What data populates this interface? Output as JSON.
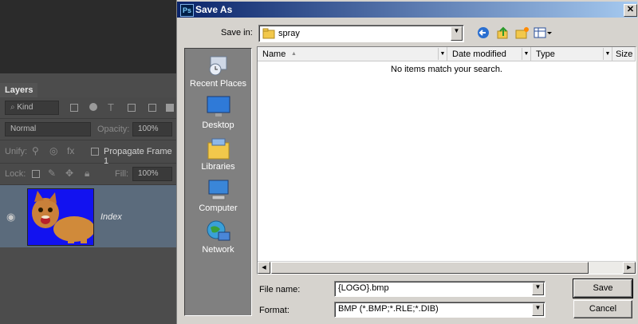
{
  "photoshop": {
    "layers_tab": "Layers",
    "filter_kind": "Kind",
    "blend_mode": "Normal",
    "opacity_label": "Opacity:",
    "opacity_value": "100%",
    "unify_label": "Unify:",
    "propagate_label": "Propagate Frame 1",
    "lock_label": "Lock:",
    "fill_label": "Fill:",
    "fill_value": "100%",
    "layer_name": "Index"
  },
  "dialog": {
    "title": "Save As",
    "app_badge": "Ps",
    "close_glyph": "✕",
    "save_in_label": "Save in:",
    "save_in_value": "spray",
    "places": [
      "Recent Places",
      "Desktop",
      "Libraries",
      "Computer",
      "Network"
    ],
    "columns": [
      "Name",
      "Date modified",
      "Type",
      "Size"
    ],
    "empty_message": "No items match your search.",
    "file_name_label": "File name:",
    "file_name_value": "{LOGO}.bmp",
    "format_label": "Format:",
    "format_value": "BMP (*.BMP;*.RLE;*.DIB)",
    "save_button": "Save",
    "cancel_button": "Cancel"
  }
}
